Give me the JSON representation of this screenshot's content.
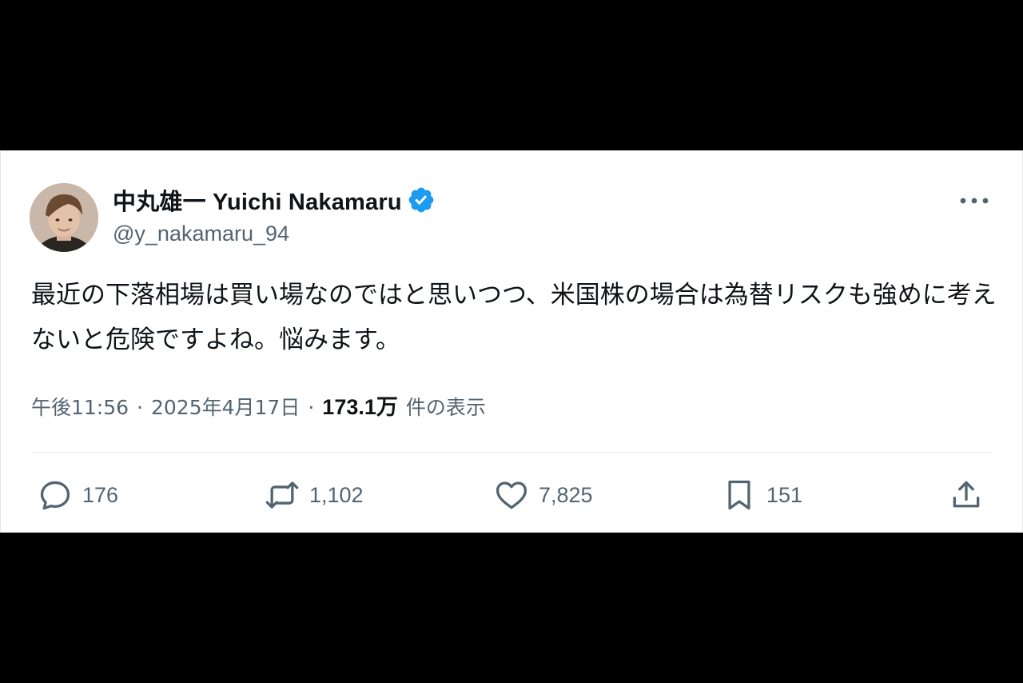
{
  "author": {
    "display_name": "中丸雄一 Yuichi Nakamaru",
    "handle": "@y_nakamaru_94",
    "verified": true
  },
  "tweet": {
    "text": "最近の下落相場は買い場なのではと思いつつ、米国株の場合は為替リスクも強めに考えないと危険ですよね。悩みます。",
    "time": "午後11:56",
    "separator": "·",
    "date": "2025年4月17日",
    "views_count": "173.1万",
    "views_label": "件の表示"
  },
  "actions": {
    "replies": "176",
    "retweets": "1,102",
    "likes": "7,825",
    "bookmarks": "151"
  },
  "icons": {
    "verified": "verified-badge-icon",
    "more": "more-horizontal-icon",
    "reply": "reply-icon",
    "retweet": "retweet-icon",
    "like": "heart-icon",
    "bookmark": "bookmark-icon",
    "share": "share-icon"
  },
  "colors": {
    "background": "#000000",
    "card": "#ffffff",
    "text_primary": "#0f1419",
    "text_secondary": "#536471",
    "verified_blue": "#1d9bf0"
  }
}
